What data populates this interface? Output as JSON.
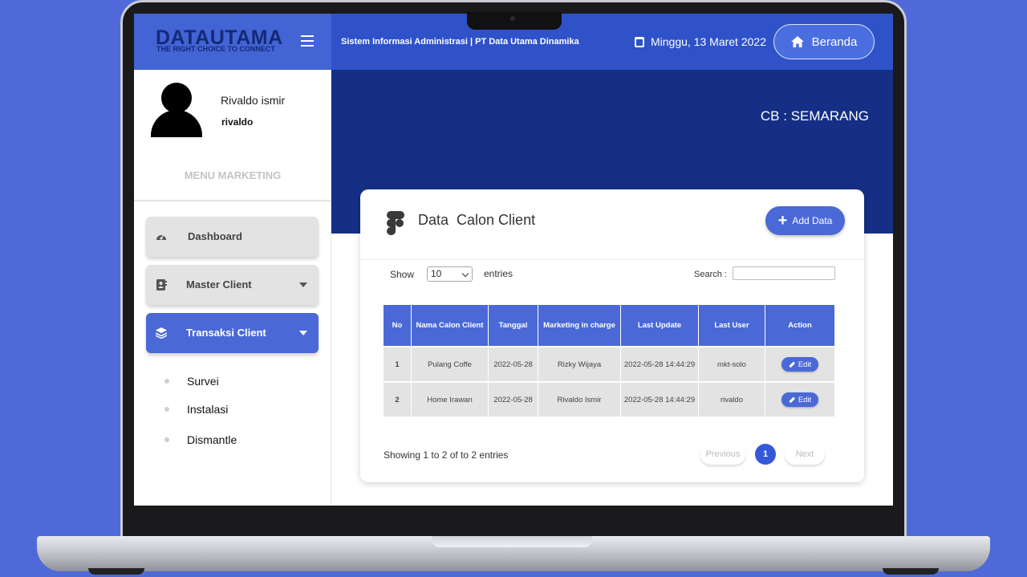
{
  "header": {
    "brand_name": "DATAUTAMA",
    "brand_tagline": "THE RIGHT CHOICE TO CONNECT",
    "system_title": "Sistem Informasi Administrasi | PT Data Utama Dinamika",
    "date": "Minggu, 13 Maret 2022",
    "home_button": "Beranda"
  },
  "user": {
    "name": "Rivaldo ismir",
    "username": "rivaldo"
  },
  "sidebar": {
    "menu_title": "MENU MARKETING",
    "items": [
      {
        "label": "Dashboard",
        "icon": "dashboard-gauge-icon"
      },
      {
        "label": "Master Client",
        "icon": "address-book-icon"
      },
      {
        "label": "Transaksi Client",
        "icon": "layers-icon"
      }
    ],
    "sub_items": [
      "Survei",
      "Instalasi",
      "Dismantle"
    ]
  },
  "branch": "CB : SEMARANG",
  "card": {
    "title": "Data  Calon Client",
    "add_button": "Add Data",
    "show_label": "Show",
    "page_size": "10",
    "entries_label": "entries",
    "search_label": "Search :",
    "columns": [
      "No",
      "Nama Calon Client",
      "Tanggal",
      "Marketing in charge",
      "Last Update",
      "Last User",
      "Action"
    ],
    "rows": [
      {
        "no": "1",
        "name": "Pulang Coffe",
        "tanggal": "2022-05-28",
        "marketing": "Rizky Wijaya",
        "last_update": "2022-05-28 14:44:29",
        "last_user": "mkt-solo",
        "action": "Edit"
      },
      {
        "no": "2",
        "name": "Home Irawan",
        "tanggal": "2022-05-28",
        "marketing": "Rivaldo Ismir",
        "last_update": "2022-05-28 14:44:29",
        "last_user": "rivaldo",
        "action": "Edit"
      }
    ],
    "showing_text": "Showing 1 to 2 of to 2 entries",
    "pagination": {
      "previous": "Previous",
      "current": "1",
      "next": "Next"
    }
  },
  "colors": {
    "accent": "#4a69d6",
    "header_blue": "#2f52c8",
    "banner_navy": "#142f85",
    "background": "#4f6ad8"
  }
}
